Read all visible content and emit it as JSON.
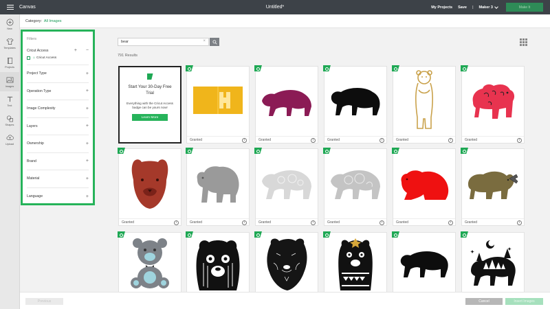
{
  "topbar": {
    "app_name": "Canvas",
    "doc_title": "Untitled*",
    "my_projects": "My Projects",
    "save": "Save",
    "divider": "|",
    "machine": "Maker 3",
    "make_it": "Make It"
  },
  "rail": [
    {
      "label": "New",
      "icon": "plus-circle-icon"
    },
    {
      "label": "Templates",
      "icon": "shirt-icon"
    },
    {
      "label": "Projects",
      "icon": "book-icon"
    },
    {
      "label": "Images",
      "icon": "image-icon"
    },
    {
      "label": "Text",
      "icon": "text-icon"
    },
    {
      "label": "Shapes",
      "icon": "shapes-icon"
    },
    {
      "label": "Upload",
      "icon": "upload-icon"
    }
  ],
  "category": {
    "label": "Category:",
    "value": "All Images"
  },
  "filters": {
    "title": "Filters",
    "cricut_access": {
      "label": "Cricut Access",
      "checkbox_label": "Cricut Access",
      "plus": "+",
      "minus": "−"
    },
    "rows": [
      "Project Type",
      "Operation Type",
      "Image Complexity",
      "Layers",
      "Ownership",
      "Brand",
      "Material",
      "Language"
    ],
    "expand_symbol": "+"
  },
  "search": {
    "value": "bear",
    "clear": "×"
  },
  "results": "791 Results",
  "promo": {
    "title": "Start Your 30-Day Free Trial",
    "body": "Everything with the Cricut Access badge can be yours now!",
    "button": "Learn More"
  },
  "cards": [
    {
      "label": "Granted",
      "info": "i",
      "art": "ticket"
    },
    {
      "label": "Granted",
      "info": "i",
      "art": "walking-bear-purple"
    },
    {
      "label": "Granted",
      "info": "i",
      "art": "walking-bear-black"
    },
    {
      "label": "Granted",
      "info": "i",
      "art": "standing-bear-outline"
    },
    {
      "label": "Granted",
      "info": "i",
      "art": "bear-red-pattern"
    },
    {
      "label": "Granted",
      "info": "i",
      "art": "bear-head-brown"
    },
    {
      "label": "Granted",
      "info": "i",
      "art": "bear-gray"
    },
    {
      "label": "Granted",
      "info": "i",
      "art": "bear-mandala-light"
    },
    {
      "label": "Granted",
      "info": "i",
      "art": "bear-mandala-gray"
    },
    {
      "label": "Granted",
      "info": "i",
      "art": "bear-sitting-red"
    },
    {
      "label": "Granted",
      "info": "i",
      "art": "bear-olive-fish"
    },
    {
      "label": "",
      "info": "",
      "art": "teddy-bear"
    },
    {
      "label": "",
      "info": "",
      "art": "bear-face-lines"
    },
    {
      "label": "",
      "info": "",
      "art": "bear-head-sketch"
    },
    {
      "label": "",
      "info": "",
      "art": "bear-tribal"
    },
    {
      "label": "",
      "info": "",
      "art": "bear-silhouette"
    },
    {
      "label": "",
      "info": "",
      "art": "bear-forest"
    }
  ],
  "bottom": {
    "previous": "Previous",
    "cancel": "Cancel",
    "insert": "Insert Images"
  }
}
